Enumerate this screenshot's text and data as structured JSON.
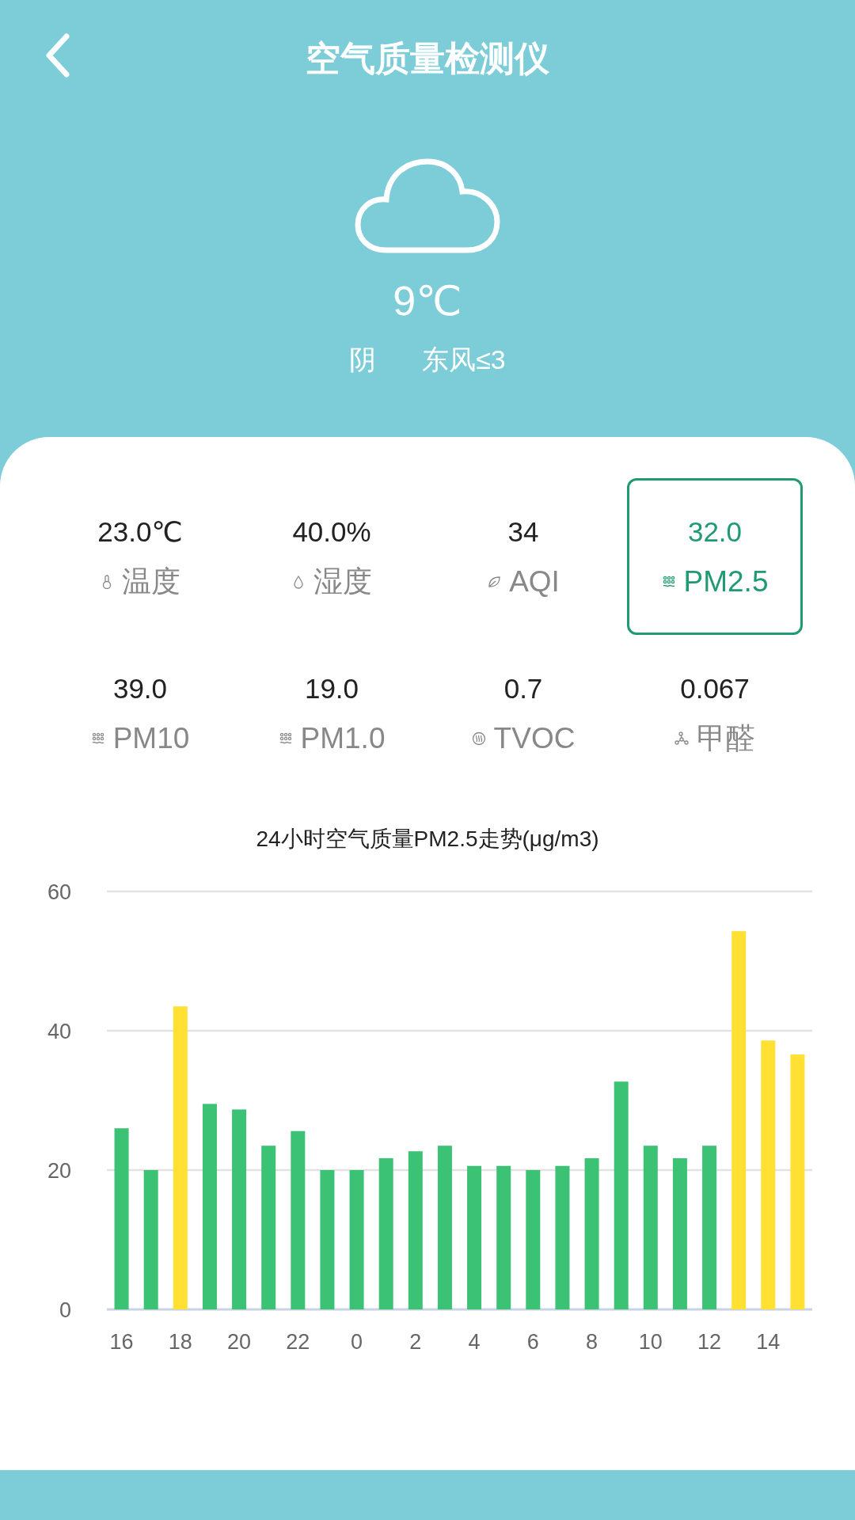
{
  "header": {
    "title": "空气质量检测仪"
  },
  "weather": {
    "temperature": "9℃",
    "condition": "阴",
    "wind": "东风≤3"
  },
  "metrics": [
    {
      "value": "23.0℃",
      "label": "温度",
      "selected": false
    },
    {
      "value": "40.0%",
      "label": "湿度",
      "selected": false
    },
    {
      "value": "34",
      "label": "AQI",
      "selected": false
    },
    {
      "value": "32.0",
      "label": "PM2.5",
      "selected": true
    },
    {
      "value": "39.0",
      "label": "PM10",
      "selected": false
    },
    {
      "value": "19.0",
      "label": "PM1.0",
      "selected": false
    },
    {
      "value": "0.7",
      "label": "TVOC",
      "selected": false
    },
    {
      "value": "0.067",
      "label": "甲醛",
      "selected": false
    }
  ],
  "chart": {
    "chart_data": {
      "type": "bar",
      "title": "24小时空气质量PM2.5走势(μg/m3)",
      "stacked": true,
      "categories": [
        "16",
        null,
        "18",
        null,
        "20",
        null,
        "22",
        null,
        "0",
        null,
        "2",
        null,
        "4",
        null,
        "6",
        null,
        "8",
        null,
        "10",
        null,
        "12",
        null,
        "14",
        null
      ],
      "ylim": [
        0,
        60
      ],
      "yticks": [
        0,
        20,
        40,
        60
      ],
      "series": [
        {
          "color": "#3cc275",
          "values": [
            26,
            20,
            null,
            29.5,
            28.7,
            23.5,
            25.6,
            20,
            20,
            21.7,
            22.7,
            23.5,
            20.6,
            20.6,
            20,
            20.6,
            21.7,
            32.7,
            23.5,
            21.7,
            23.5,
            null,
            null,
            null
          ]
        },
        {
          "color": "#ffe033",
          "values": [
            null,
            null,
            43.5,
            null,
            null,
            null,
            null,
            null,
            null,
            null,
            null,
            null,
            null,
            null,
            null,
            null,
            null,
            null,
            null,
            null,
            null,
            54.3,
            38.6,
            36.6
          ]
        }
      ]
    }
  }
}
